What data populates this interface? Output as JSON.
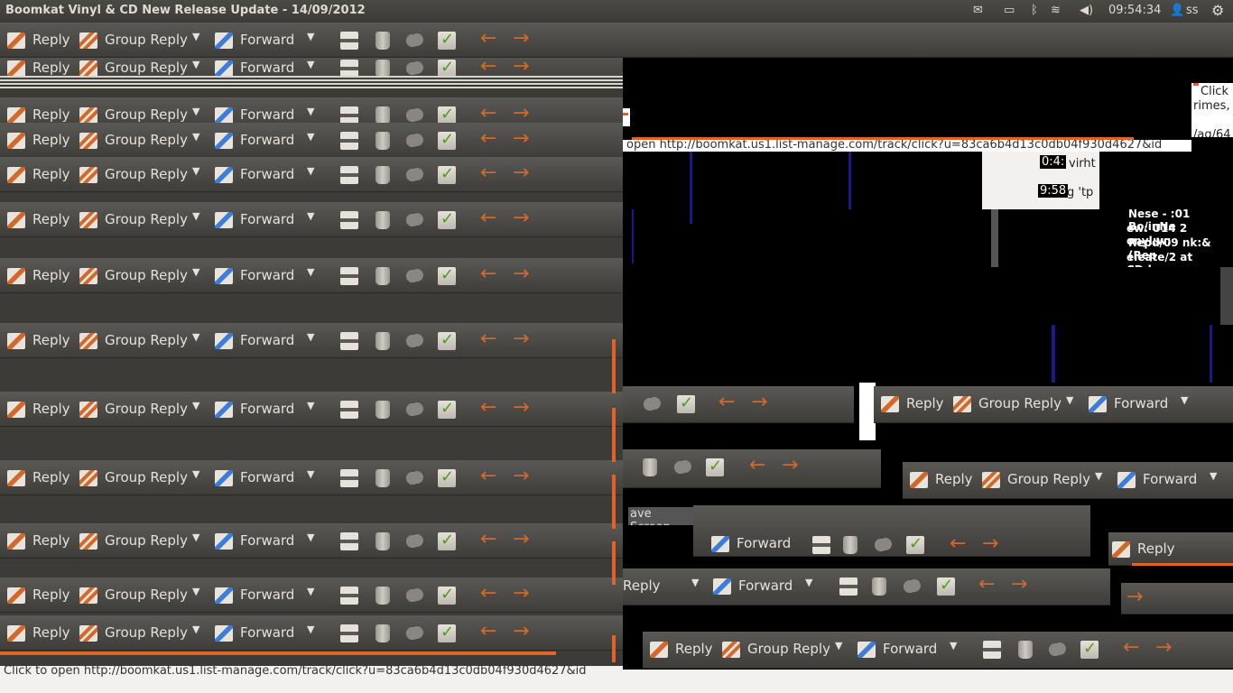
{
  "window": {
    "title": "Boomkat Vinyl & CD New Release Update - 14/09/2012"
  },
  "panel": {
    "clock": "09:54:34",
    "user": "ss"
  },
  "toolbar": {
    "reply_label": "Reply",
    "group_reply_label": "Group Reply",
    "forward_label": "Forward",
    "dropdown_glyph": "▼",
    "back_glyph": "←",
    "forward_arrow_glyph": "→",
    "icons": [
      "reply-icon",
      "group-reply-icon",
      "forward-icon",
      "print-icon",
      "delete-icon",
      "junk-icon",
      "mark-read-icon",
      "back-arrow-icon",
      "forward-arrow-icon"
    ]
  },
  "status": {
    "link_text": "Click to open http://boomkat.us1.list-manage.com/track/click?u=83ca6b4d13c0db04f930d4627&id"
  },
  "glitch_text": {
    "link_fragment": "open http://boomkat.us1.list-manage.com/track/click?u=83ca6b4d13c0db04f930d4627&id",
    "time_a": "0:4:",
    "text_a": "virht",
    "time_b": "9:58",
    "text_b": "g 'tp",
    "list_lines": [
      "Nese - :01 Bo/inNe",
      "ew: U14 2 onyl:w:",
      "Repd/09 nk:& (Rep",
      "eleate/2 at CD:lea"
    ],
    "side_a": "Click",
    "side_b": "rimes,",
    "side_c": "/ag/64",
    "save_screen": "ave Screen"
  },
  "colors": {
    "toolbar_bg": "#4a4945",
    "accent": "#e0642a",
    "panel_bg": "#3c3b37"
  }
}
